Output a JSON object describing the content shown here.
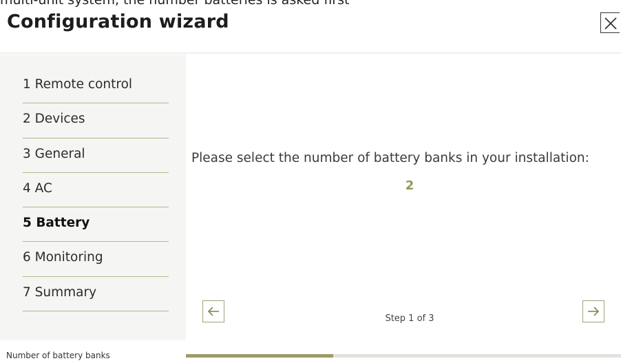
{
  "caption_top": "multi-unit system, the number batteries is asked first",
  "window": {
    "title": "Configuration wizard"
  },
  "sidebar": {
    "items": [
      {
        "label": "1 Remote control",
        "active": false
      },
      {
        "label": "2 Devices",
        "active": false
      },
      {
        "label": "3 General",
        "active": false
      },
      {
        "label": "4 AC",
        "active": false
      },
      {
        "label": "5 Battery",
        "active": true
      },
      {
        "label": "6 Monitoring",
        "active": false
      },
      {
        "label": "7 Summary",
        "active": false
      }
    ]
  },
  "main": {
    "prompt": "Please select the number of battery banks in your installation:",
    "value": "2",
    "step_text": "Step 1 of 3",
    "progress": 0.338
  },
  "footer": {
    "label": "Number of battery banks"
  },
  "icons": {
    "close": "close-icon",
    "prev": "arrow-left-icon",
    "next": "arrow-right-icon"
  },
  "colors": {
    "accent": "#8a9a5b",
    "sidebar_bg": "#f5f5f3",
    "divider": "#b6b38f",
    "progress_fill": "#a09a6a"
  }
}
